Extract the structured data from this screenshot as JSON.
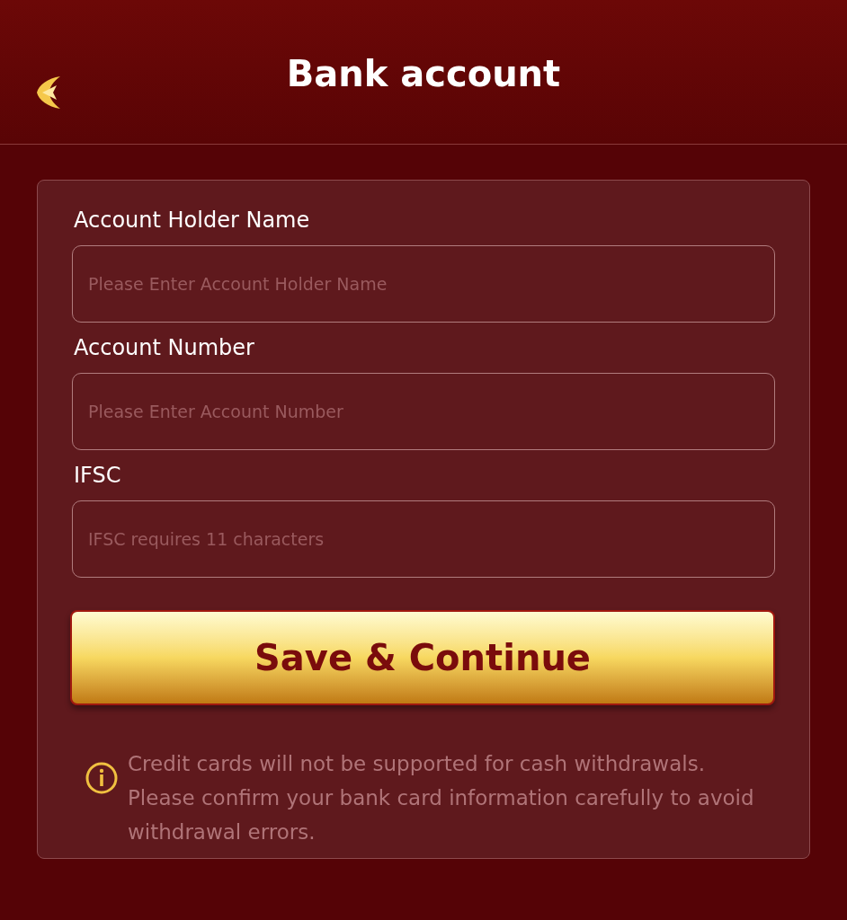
{
  "header": {
    "title": "Bank account"
  },
  "fields": [
    {
      "label": "Account Holder Name",
      "placeholder": "Please Enter Account Holder Name"
    },
    {
      "label": "Account Number",
      "placeholder": "Please Enter Account Number"
    },
    {
      "label": "IFSC",
      "placeholder": "IFSC requires 11 characters"
    }
  ],
  "submit_button": "Save & Continue",
  "notice": {
    "lines": [
      "Credit cards will not be supported for cash withdrawals.",
      "Please confirm your bank card information carefully to avoid withdrawal errors."
    ]
  }
}
